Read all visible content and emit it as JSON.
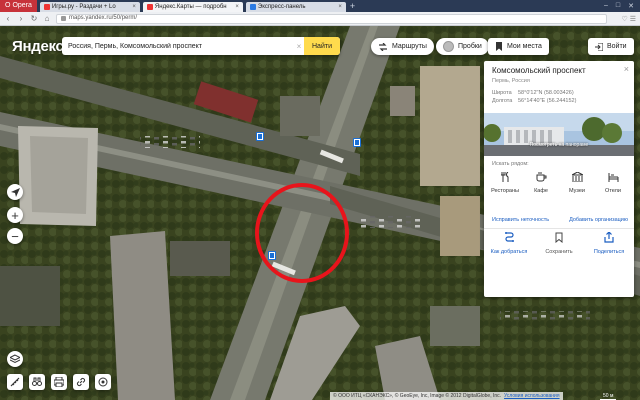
{
  "browser": {
    "menu_label": "Opera",
    "tabs": [
      {
        "label": "Игры.ру - Раздачи + Lo",
        "favicon": "red"
      },
      {
        "label": "Яндекс.Карты — подробн",
        "favicon": "red",
        "active": true
      },
      {
        "label": "Экспресс-панель",
        "favicon": "blue"
      }
    ],
    "new_tab": "+",
    "url": "maps.yandex.ru/50/perm/"
  },
  "map": {
    "logo": "Яндекс",
    "search": {
      "value": "Россия, Пермь, Комсомольский проспект",
      "button": "Найти"
    },
    "toolbar": {
      "routes": "Маршруты",
      "traffic": "Пробки",
      "places": "Мои места",
      "login": "Войти"
    },
    "copyright": {
      "text": "© ООО ИТЦ «СКАНЭКС», © GeoEye, Inc, Image © 2012 DigitalGlobe, Inc.",
      "terms": "Условия использования"
    },
    "scale_label": "50 м"
  },
  "panel": {
    "title": "Комсомольский проспект",
    "subtitle": "Пермь, Россия",
    "latitude_label": "Широта",
    "latitude_value": "58°0'12\"N (58.003426)",
    "longitude_label": "Долгота",
    "longitude_value": "56°14'40\"E (56.244152)",
    "panorama_label": "Посмотреть на панораме",
    "nearby_label": "Искать рядом:",
    "categories": [
      {
        "label": "Рестораны",
        "icon": "fork-knife-icon"
      },
      {
        "label": "Кафе",
        "icon": "coffee-cup-icon"
      },
      {
        "label": "Музеи",
        "icon": "museum-icon"
      },
      {
        "label": "Отели",
        "icon": "bed-icon"
      }
    ],
    "fix_link": "Исправить неточность",
    "add_org_link": "Добавить организацию",
    "actions": [
      {
        "label": "Как добраться",
        "icon": "route-icon"
      },
      {
        "label": "Сохранить",
        "icon": "bookmark-icon"
      },
      {
        "label": "Поделиться",
        "icon": "share-icon"
      }
    ]
  },
  "colors": {
    "yandex_yellow": "#ffdb4d",
    "highlight_red": "#e8141b",
    "link_blue": "#1a5dc1"
  }
}
